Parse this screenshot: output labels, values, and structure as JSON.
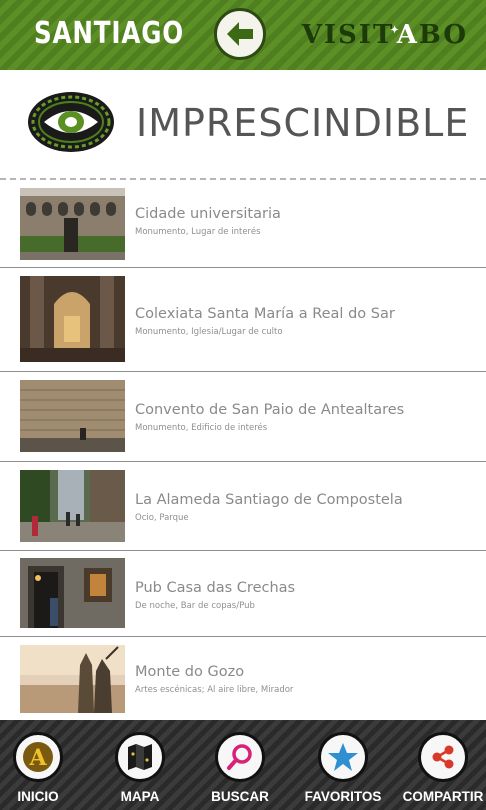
{
  "header": {
    "city": "SANTIAGO",
    "brand_before": "VISIT",
    "brand_after": "BO",
    "brand_accent": "A",
    "back_icon": "arrow-left-icon",
    "color_green": "#4f7f1f"
  },
  "section": {
    "title": "IMPRESCINDIBLE",
    "logo_icon": "eye-icon"
  },
  "places": [
    {
      "name": "Cidade universitaria",
      "category": "Monumento, Lugar de interés"
    },
    {
      "name": "Colexiata Santa María a Real do Sar",
      "category": "Monumento, Iglesia/Lugar de culto"
    },
    {
      "name": "Convento de San Paio de Antealtares",
      "category": "Monumento, Edificio de interés"
    },
    {
      "name": "La Alameda Santiago de Compostela",
      "category": "Ocio, Parque"
    },
    {
      "name": "Pub Casa das Crechas",
      "category": "De noche, Bar de copas/Pub"
    },
    {
      "name": "Monte do Gozo",
      "category": "Artes escénicas; Al aire libre, Mirador"
    }
  ],
  "nav": [
    {
      "label": "INICIO",
      "icon": "home-a-icon"
    },
    {
      "label": "MAPA",
      "icon": "map-icon"
    },
    {
      "label": "BUSCAR",
      "icon": "search-icon"
    },
    {
      "label": "FAVORITOS",
      "icon": "star-icon"
    },
    {
      "label": "COMPARTIR",
      "icon": "share-icon"
    }
  ]
}
